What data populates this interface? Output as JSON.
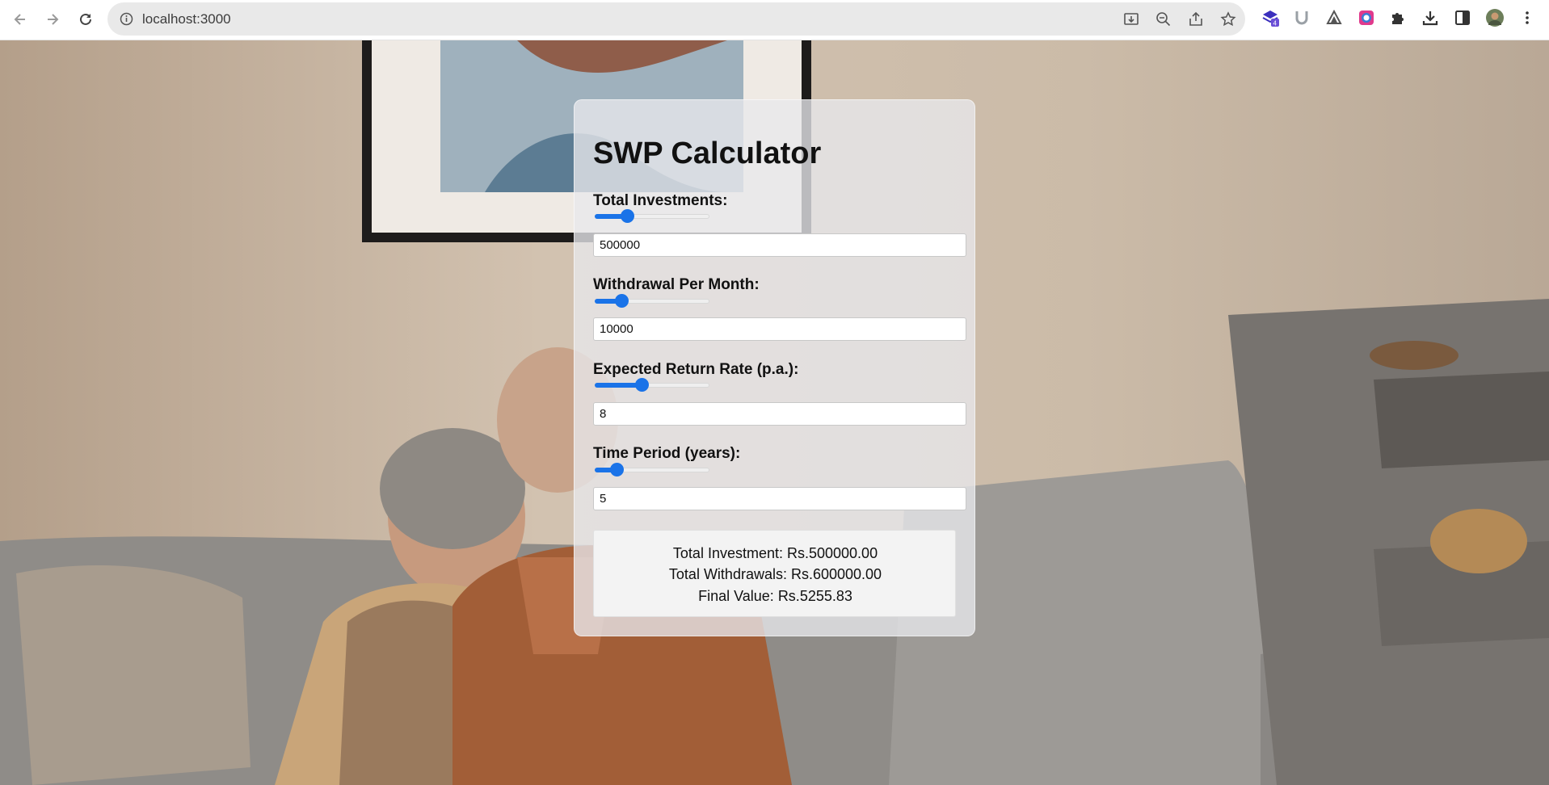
{
  "browser": {
    "url": "localhost:3000",
    "extension_badge": "4",
    "icons": {
      "back": "arrow-left-icon",
      "forward": "arrow-right-icon",
      "reload": "reload-icon",
      "site_info": "info-icon",
      "install": "install-icon",
      "zoom": "zoom-out-icon",
      "share": "share-icon",
      "bookmark": "star-icon"
    }
  },
  "calculator": {
    "title": "SWP Calculator",
    "fields": [
      {
        "label": "Total Investments:",
        "value": "500000",
        "slider_fraction": 0.28
      },
      {
        "label": "Withdrawal Per Month:",
        "value": "10000",
        "slider_fraction": 0.23
      },
      {
        "label": "Expected Return Rate (p.a.):",
        "value": "8",
        "slider_fraction": 0.41
      },
      {
        "label": "Time Period (years):",
        "value": "5",
        "slider_fraction": 0.19
      }
    ],
    "results": {
      "total_investment": "Total Investment: Rs.500000.00",
      "total_withdrawals": "Total Withdrawals: Rs.600000.00",
      "final_value": "Final Value: Rs.5255.83"
    }
  },
  "colors": {
    "accent": "#1a73e8",
    "card": "#e8e8ec"
  }
}
